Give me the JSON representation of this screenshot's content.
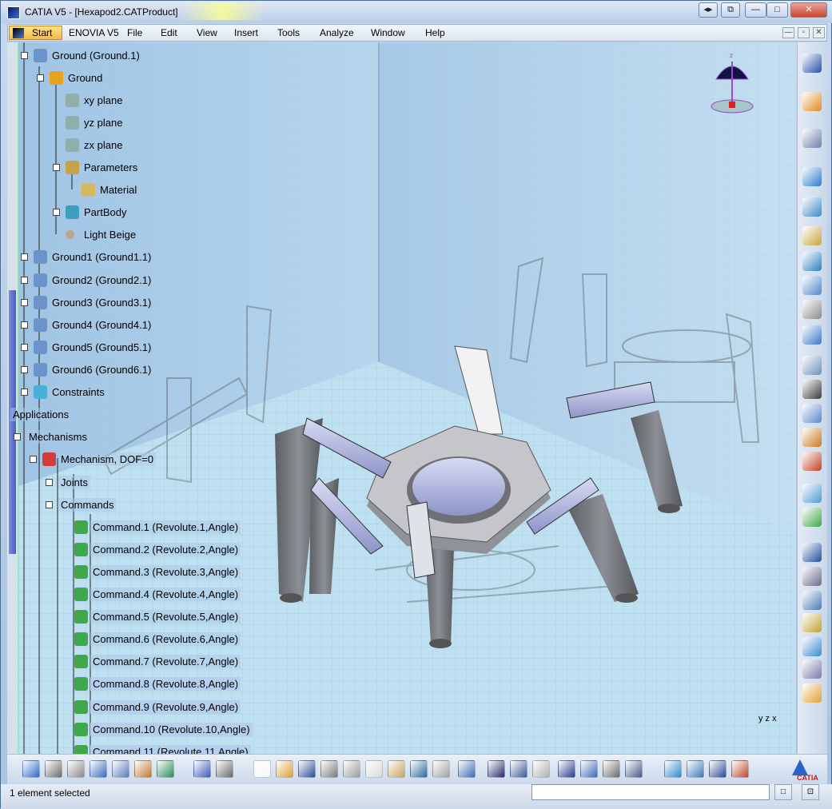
{
  "window": {
    "title": "CATIA V5 - [Hexapod2.CATProduct]",
    "controls": {
      "minimize": "—",
      "maximize": "□",
      "close": "✕",
      "extra1": "◂▸",
      "extra2": "⧉"
    }
  },
  "menubar": {
    "items": [
      "Start",
      "ENOVIA V5",
      "File",
      "Edit",
      "View",
      "Insert",
      "Tools",
      "Analyze",
      "Window",
      "Help"
    ],
    "mdi": {
      "minimize": "—",
      "restore": "▫",
      "close": "✕"
    }
  },
  "tree": {
    "nodes": [
      {
        "label": "Ground (Ground.1)",
        "icon": "product-icon"
      },
      {
        "label": "Ground",
        "icon": "part-gear-icon"
      },
      {
        "label": "xy plane",
        "icon": "plane-icon"
      },
      {
        "label": "yz plane",
        "icon": "plane-icon"
      },
      {
        "label": "zx plane",
        "icon": "plane-icon"
      },
      {
        "label": "Parameters",
        "icon": "parameters-icon"
      },
      {
        "label": "Material",
        "icon": "material-icon"
      },
      {
        "label": "PartBody",
        "icon": "gear-icon"
      },
      {
        "label": "Light Beige",
        "icon": "sphere-icon"
      },
      {
        "label": "Ground1 (Ground1.1)",
        "icon": "product-icon"
      },
      {
        "label": "Ground2 (Ground2.1)",
        "icon": "product-icon"
      },
      {
        "label": "Ground3 (Ground3.1)",
        "icon": "product-icon"
      },
      {
        "label": "Ground4 (Ground4.1)",
        "icon": "product-icon"
      },
      {
        "label": "Ground5 (Ground5.1)",
        "icon": "product-icon"
      },
      {
        "label": "Ground6 (Ground6.1)",
        "icon": "product-icon"
      },
      {
        "label": "Constraints",
        "icon": "constraints-icon"
      },
      {
        "label": "Applications",
        "icon": ""
      },
      {
        "label": "Mechanisms",
        "icon": ""
      },
      {
        "label": "Mechanism, DOF=0",
        "icon": "mechanism-icon"
      },
      {
        "label": "Joints",
        "icon": ""
      },
      {
        "label": "Commands",
        "icon": ""
      },
      {
        "label": "Command.1 (Revolute.1,Angle)",
        "icon": "command-icon"
      },
      {
        "label": "Command.2 (Revolute.2,Angle)",
        "icon": "command-icon"
      },
      {
        "label": "Command.3 (Revolute.3,Angle)",
        "icon": "command-icon"
      },
      {
        "label": "Command.4 (Revolute.4,Angle)",
        "icon": "command-icon"
      },
      {
        "label": "Command.5 (Revolute.5,Angle)",
        "icon": "command-icon"
      },
      {
        "label": "Command.6 (Revolute.6,Angle)",
        "icon": "command-icon"
      },
      {
        "label": "Command.7 (Revolute.7,Angle)",
        "icon": "command-icon"
      },
      {
        "label": "Command.8 (Revolute.8,Angle)",
        "icon": "command-icon"
      },
      {
        "label": "Command.9 (Revolute.9,Angle)",
        "icon": "command-icon"
      },
      {
        "label": "Command.10 (Revolute.10,Angle)",
        "icon": "command-icon"
      },
      {
        "label": "Command.11 (Revolute.11,Angle)",
        "icon": "command-icon"
      }
    ]
  },
  "viewport": {
    "compass_label": "z",
    "axis_label": "y z x"
  },
  "right_toolbar": {
    "icons": [
      "catia-compass-icon",
      "select-arrow-icon",
      "snap-icon",
      "rotate-icon",
      "update-icon",
      "manipulate-icon",
      "anchor-icon",
      "constraint-icon",
      "fix-icon",
      "explode-icon",
      "clash-icon",
      "simulate-icon",
      "replay-icon",
      "sequence-icon",
      "sensors-icon",
      "law-icon",
      "speed-icon",
      "swept-volume-icon",
      "trace-icon",
      "distance-icon",
      "mechanism-analysis-icon",
      "kinematics-icon",
      "joint-icon",
      "fixed-part-icon",
      "assembly-icon",
      "home-icon",
      "exit-icon"
    ]
  },
  "bottom_toolbar": {
    "icons": [
      "target-icon",
      "first-frame-icon",
      "last-frame-icon",
      "zoom-icon",
      "compass-reset-icon",
      "render-icon",
      "color-icon",
      "measure-icon",
      "cut-view-icon",
      "new-icon",
      "open-icon",
      "save-icon",
      "print-icon",
      "cut-icon",
      "copy-icon",
      "paste-icon",
      "undo-icon",
      "redo-icon",
      "whats-this-icon",
      "formula-icon",
      "comment-icon",
      "light-icon",
      "table-icon",
      "hierarchy-icon",
      "lock-icon",
      "knowledge-icon",
      "fly-icon",
      "fit-all-icon",
      "pan-icon",
      "rotate-view-icon"
    ],
    "logo_text": "CATIA"
  },
  "status": {
    "text": "1 element selected",
    "input_value": "",
    "btn1": "□",
    "btn2": "⊡"
  },
  "colors": {
    "selection": "#b5d0ef",
    "viewport_top": "#b3d3ec",
    "viewport_floor": "#bfe0f1",
    "start_menu": "#f6b94a"
  }
}
